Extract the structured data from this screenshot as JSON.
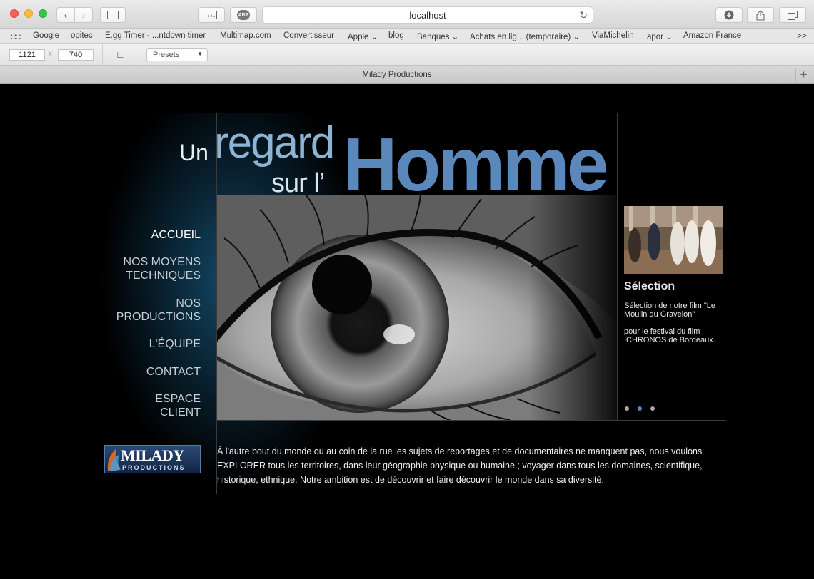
{
  "browser": {
    "address": "localhost",
    "tab_title": "Milady Productions",
    "abp_label": "ABP",
    "bookmarks": [
      "Google",
      "opitec",
      "E.gg Timer - ...ntdown timer",
      "Multimap.com",
      "Convertisseur",
      "Apple",
      "blog",
      "Banques",
      "Achats en lig... (temporaire)",
      "ViaMichelin",
      "apor",
      "Amazon France"
    ],
    "more": ">>",
    "dev": {
      "width": "1121",
      "height": "740",
      "x": "x",
      "presets": "Presets"
    }
  },
  "header": {
    "un": "Un",
    "regard": "regard",
    "sur": "sur l’",
    "homme": "Homme"
  },
  "nav": {
    "items": [
      {
        "line1": "ACCUEIL",
        "line2": ""
      },
      {
        "line1": "NOS MOYENS",
        "line2": "TECHNIQUES"
      },
      {
        "line1": "NOS",
        "line2": "PRODUCTIONS"
      },
      {
        "line1": "L'ÉQUIPE",
        "line2": ""
      },
      {
        "line1": "CONTACT",
        "line2": ""
      },
      {
        "line1": "ESPACE",
        "line2": "CLIENT"
      }
    ]
  },
  "logo": {
    "main": "MILADY",
    "sub": "PRODUCTIONS"
  },
  "selection": {
    "title": "Sélection",
    "text1": "Sélection de notre film \"Le Moulin du Gravelon\"",
    "text2": "pour le festival du film ICHRONOS de Bordeaux."
  },
  "intro": "À l'autre bout du monde ou au coin de la rue les sujets de reportages et de documentaires ne manquent pas, nous voulons EXPLORER tous les territoires, dans leur géographie physique ou humaine ; voyager dans tous les domaines, scientifique, historique, ethnique. Notre ambition est de découvrir et faire découvrir le monde dans sa diversité.",
  "carousel": {
    "count": 3,
    "active": 2
  }
}
